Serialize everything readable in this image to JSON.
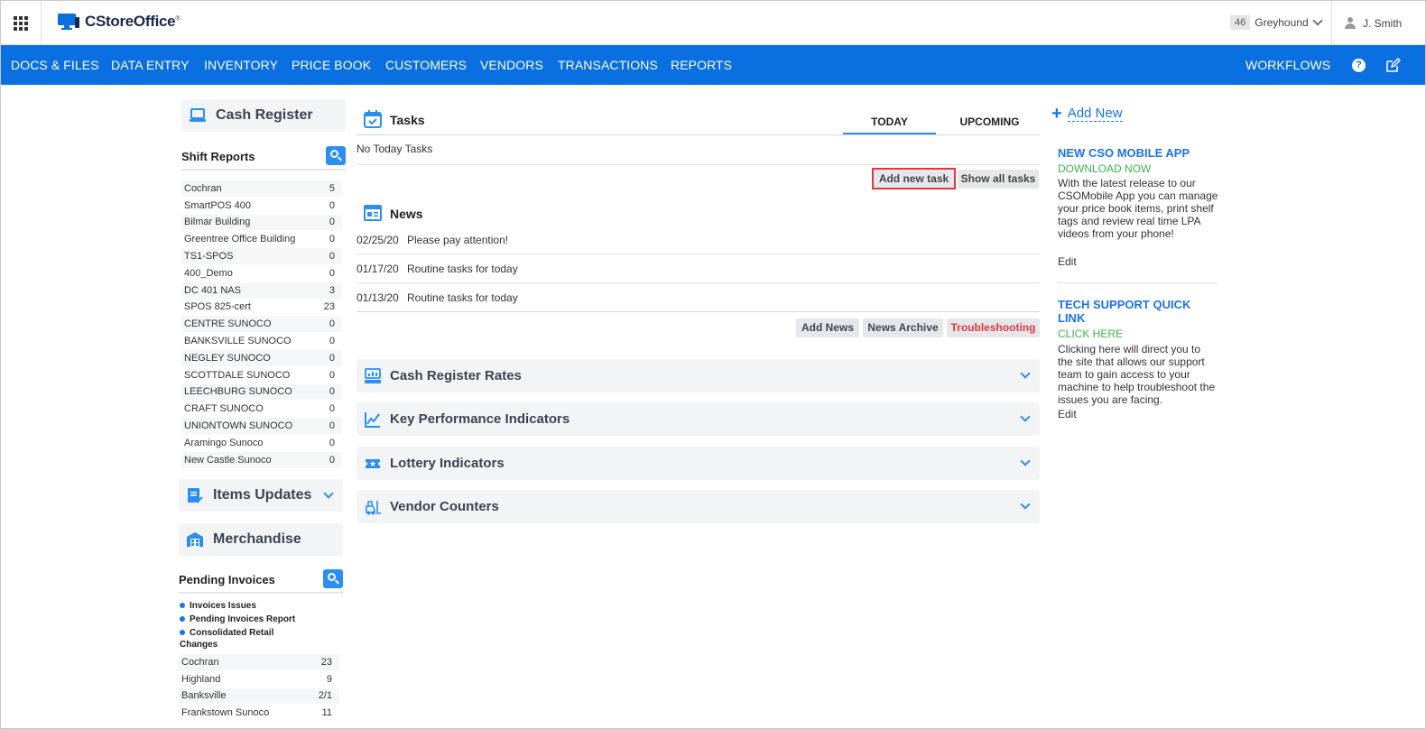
{
  "app": {
    "logo_text": "CStoreOffice",
    "logo_mark": "®",
    "store_number": "46",
    "store_name": "Greyhound",
    "user_name": "J. Smith"
  },
  "nav": {
    "items": [
      "DOCS & FILES",
      "DATA ENTRY",
      "INVENTORY",
      "PRICE BOOK",
      "CUSTOMERS",
      "VENDORS",
      "TRANSACTIONS",
      "REPORTS"
    ],
    "workflows": "WORKFLOWS",
    "help_icon": "?",
    "icons": [
      "help-icon",
      "edit-icon"
    ]
  },
  "left": {
    "cash_register_title": "Cash Register",
    "shift_reports_title": "Shift Reports",
    "shift_reports": [
      {
        "name": "Cochran",
        "count": "5"
      },
      {
        "name": "SmartPOS 400",
        "count": "0"
      },
      {
        "name": "Bilmar Building",
        "count": "0"
      },
      {
        "name": "Greentree Office Building",
        "count": "0"
      },
      {
        "name": "TS1-SPOS",
        "count": "0"
      },
      {
        "name": "400_Demo",
        "count": "0"
      },
      {
        "name": "DC 401 NAS",
        "count": "3"
      },
      {
        "name": "SPOS 825-cert",
        "count": "23"
      },
      {
        "name": "CENTRE SUNOCO",
        "count": "0"
      },
      {
        "name": "BANKSVILLE SUNOCO",
        "count": "0"
      },
      {
        "name": "NEGLEY SUNOCO",
        "count": "0"
      },
      {
        "name": "SCOTTDALE SUNOCO",
        "count": "0"
      },
      {
        "name": "LEECHBURG SUNOCO",
        "count": "0"
      },
      {
        "name": "CRAFT SUNOCO",
        "count": "0"
      },
      {
        "name": "UNIONTOWN SUNOCO",
        "count": "0"
      },
      {
        "name": "Aramingo Sunoco",
        "count": "0"
      },
      {
        "name": "New Castle Sunoco",
        "count": "0"
      }
    ],
    "items_updates_title": "Items Updates",
    "merchandise_title": "Merchandise",
    "pending_invoices_title": "Pending Invoices",
    "pending_links": [
      "Invoices Issues",
      "Pending Invoices Report",
      "Consolidated Retail Changes"
    ],
    "pending_invoices": [
      {
        "name": "Cochran",
        "count": "23"
      },
      {
        "name": "Highland",
        "count": "9"
      },
      {
        "name": "Banksville",
        "count": "2/1"
      },
      {
        "name": "Frankstown Sunoco",
        "count": "11"
      }
    ]
  },
  "center": {
    "tasks_title": "Tasks",
    "tab_today": "TODAY",
    "tab_upcoming": "UPCOMING",
    "no_tasks": "No Today Tasks",
    "add_task_label": "Add new task",
    "show_all_label": "Show all tasks",
    "news_title": "News",
    "news": [
      {
        "date": "02/25/20",
        "title": "Please pay attention!"
      },
      {
        "date": "01/17/20",
        "title": "Routine tasks for today"
      },
      {
        "date": "01/13/20",
        "title": "Routine tasks for today"
      }
    ],
    "add_news_label": "Add News",
    "news_archive_label": "News Archive",
    "troubleshooting_label": "Troubleshooting",
    "accordions": [
      {
        "title": "Cash Register Rates",
        "icon": "cash-register-rates-icon"
      },
      {
        "title": "Key Performance Indicators",
        "icon": "kpi-chart-icon"
      },
      {
        "title": "Lottery Indicators",
        "icon": "lottery-ticket-icon"
      },
      {
        "title": "Vendor Counters",
        "icon": "forklift-icon"
      }
    ]
  },
  "right": {
    "add_new_label": "Add New",
    "widget1": {
      "title": "NEW CSO MOBILE APP",
      "link": "DOWNLOAD NOW",
      "body": "With the latest release to our CSOMobile App you can manage your price book items, print shelf tags and review real time LPA videos from your phone!",
      "edit": "Edit"
    },
    "widget2": {
      "title": "TECH SUPPORT QUICK LINK",
      "link": "CLICK HERE",
      "body": "Clicking here will direct you to the site that allows our support team to gain access to your machine to help troubleshoot the issues you are facing.",
      "edit": "Edit"
    }
  },
  "colors": {
    "nav_blue": "#0a6fe0",
    "accent_blue": "#2c8ff0",
    "link_green": "#3ab54a",
    "troubleshoot_red": "#e0383e",
    "highlight_red": "#e0383e"
  }
}
